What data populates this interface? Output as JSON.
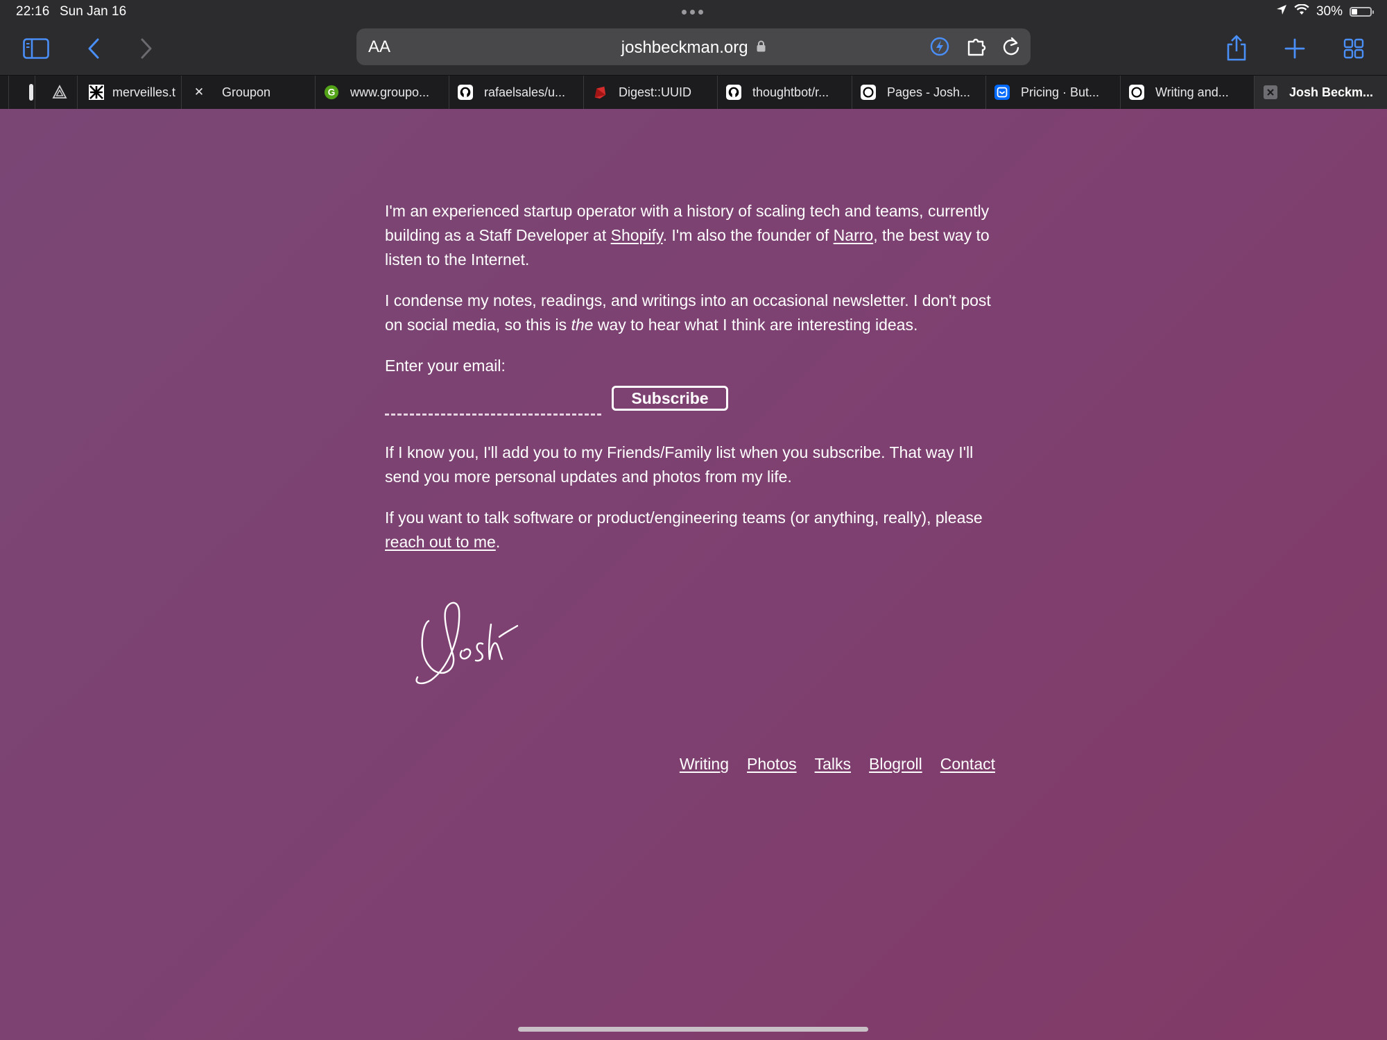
{
  "status_bar": {
    "time": "22:16",
    "date": "Sun Jan 16",
    "battery_text": "30%",
    "battery_level": 0.3
  },
  "toolbar": {
    "reader_label": "AA",
    "url": "joshbeckman.org",
    "icons": [
      "sidebar-icon",
      "back-icon",
      "forward-icon",
      "lock-icon",
      "privacy-icon",
      "extension-icon",
      "reload-icon",
      "share-icon",
      "new-tab-icon",
      "tab-overview-icon"
    ]
  },
  "tabs": [
    {
      "label": "merveilles.t",
      "icon": "merveilles-favicon"
    },
    {
      "label": "Groupon",
      "icon": "close-icon"
    },
    {
      "label": "www.groupo...",
      "icon": "groupon-favicon"
    },
    {
      "label": "rafaelsales/u...",
      "icon": "github-favicon"
    },
    {
      "label": "Digest::UUID",
      "icon": "ruby-favicon"
    },
    {
      "label": "thoughtbot/r...",
      "icon": "github-favicon"
    },
    {
      "label": "Pages - Josh...",
      "icon": "circle-favicon"
    },
    {
      "label": "Pricing · But...",
      "icon": "buttondown-favicon"
    },
    {
      "label": "Writing and...",
      "icon": "circle-favicon"
    },
    {
      "label": "Josh Beckm...",
      "icon": "close-icon",
      "active": true
    }
  ],
  "page": {
    "intro": {
      "before_shopify": "I'm an experienced startup operator with a history of scaling tech and teams, currently building as a Staff Developer at ",
      "shopify_link": "Shopify",
      "between": ". I'm also the founder of ",
      "narro_link": "Narro",
      "after": ", the best way to listen to the Internet."
    },
    "newsletter": {
      "before_em": "I condense my notes, readings, and writings into an occasional newsletter. I don't post on social media, so this is ",
      "em": "the",
      "after_em": " way to hear what I think are interesting ideas."
    },
    "email_label": "Enter your email:",
    "email_value": "",
    "subscribe_label": "Subscribe",
    "friends_text": "If I know you, I'll add you to my Friends/Family list when you subscribe. That way I'll send you more personal updates and photos from my life.",
    "talk": {
      "before": "If you want to talk software or product/engineering teams (or anything, really), please ",
      "link": "reach out to me",
      "after": "."
    },
    "signature": "Josh",
    "footer_links": [
      "Writing",
      "Photos",
      "Talks",
      "Blogroll",
      "Contact"
    ]
  },
  "colors": {
    "page_bg_start": "#7a4775",
    "page_bg_end": "#823a66",
    "accent_blue": "#4a8ff7"
  }
}
